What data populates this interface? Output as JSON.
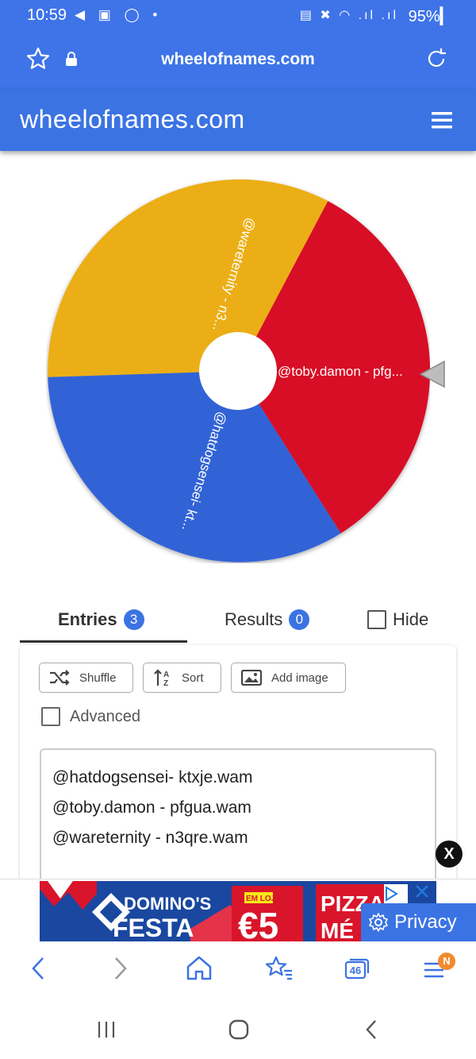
{
  "status_bar": {
    "time": "10:59",
    "left_icons": "◀ ▣ ◯ •",
    "right_icons": "▤ ✖ ◠ .ıl .ıl",
    "battery": "95%▎"
  },
  "browser": {
    "url": "wheelofnames.com",
    "tab_count": "46",
    "nav_badge": "N"
  },
  "site_header": {
    "brand": "wheelofnames.com"
  },
  "wheel": {
    "colors": {
      "red": "#d80f26",
      "yellow": "#ecae14",
      "blue": "#3164d6"
    },
    "segments": [
      {
        "label": "@toby.damon - pfg..."
      },
      {
        "label": "@wareternity - n3..."
      },
      {
        "label": "@hatdogsensei- kt..."
      }
    ]
  },
  "tabs": {
    "entries_label": "Entries",
    "entries_count": "3",
    "results_label": "Results",
    "results_count": "0",
    "hide_label": "Hide"
  },
  "toolbar": {
    "shuffle_label": "Shuffle",
    "sort_label": "Sort",
    "add_image_label": "Add image",
    "advanced_label": "Advanced"
  },
  "entries": [
    "@hatdogsensei- ktxje.wam",
    "@toby.damon - pfgua.wam",
    "@wareternity - n3qre.wam"
  ],
  "ad": {
    "close_label": "X",
    "brand": "DOMINO'S",
    "festa": "FESTA",
    "em_loja": "EM LOJA",
    "price": "€5",
    "pizza": "PIZZA",
    "pizza2": "MÉ",
    "privacy_label": "Privacy"
  }
}
